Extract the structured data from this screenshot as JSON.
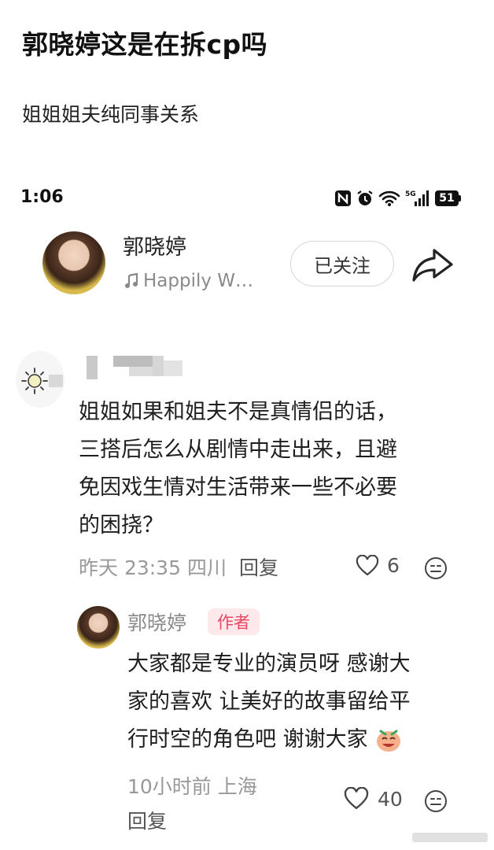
{
  "post": {
    "title": "郭晓婷这是在拆cp吗",
    "body": "姐姐姐夫纯同事关系"
  },
  "status_bar": {
    "time": "1:06",
    "battery": "51",
    "network": "5G"
  },
  "profile": {
    "name": "郭晓婷",
    "music": "Happily W…",
    "follow_label": "已关注"
  },
  "comment": {
    "lines": [
      "姐姐如果和姐夫不是真情侣的话，",
      "三搭后怎么从剧情中走出来，且避",
      "免因戏生情对生活带来一些不必要",
      "的困挠？"
    ],
    "time": "昨天 23:35",
    "location": "四川",
    "reply_label": "回复",
    "likes": "6"
  },
  "reply": {
    "name": "郭晓婷",
    "badge": "作者",
    "lines": [
      "大家都是专业的演员呀 感谢大",
      "家的喜欢 让美好的故事留给平",
      "行时空的角色吧 谢谢大家"
    ],
    "meta": "10小时前 上海",
    "reply_label": "回复",
    "likes": "40"
  },
  "colors": {
    "badge_text": "#e5485f",
    "badge_bg": "#fde9ec",
    "muted": "#999999"
  }
}
